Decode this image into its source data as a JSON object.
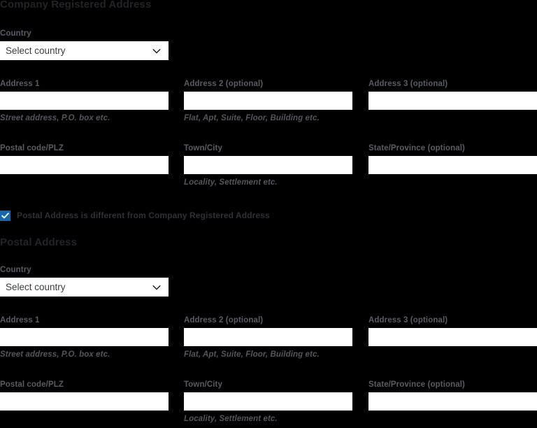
{
  "theme": {
    "background": "#000000",
    "heading_color": "#232427",
    "label_color": "#585c63",
    "helper_color": "#52565c",
    "input_background": "#ffffff",
    "checkbox_accent": "#1768ab"
  },
  "sections": [
    {
      "id": "company-registered-address",
      "heading": "Company Registered Address",
      "country": {
        "label": "Country",
        "placeholder": "Select country",
        "value": "Select country",
        "options": [
          "Select country"
        ],
        "chevron_icon": "chevron-down-icon"
      },
      "row1": [
        {
          "label": "Address 1",
          "value": "",
          "helper": "Street address, P.O. box etc."
        },
        {
          "label": "Address 2 (optional)",
          "value": "",
          "helper": "Flat, Apt, Suite, Floor, Building etc."
        },
        {
          "label": "Address 3 (optional)",
          "value": "",
          "helper": ""
        }
      ],
      "row2": [
        {
          "label": "Postal code/PLZ",
          "value": "",
          "helper": ""
        },
        {
          "label": "Town/City",
          "value": "",
          "helper": "Locality, Settlement etc."
        },
        {
          "label": "State/Province (optional)",
          "value": "",
          "helper": ""
        }
      ]
    },
    {
      "id": "postal-address",
      "heading": "Postal Address",
      "country": {
        "label": "Country",
        "placeholder": "Select country",
        "value": "Select country",
        "options": [
          "Select country"
        ],
        "chevron_icon": "chevron-down-icon"
      },
      "row1": [
        {
          "label": "Address 1",
          "value": "",
          "helper": "Street address, P.O. box etc."
        },
        {
          "label": "Address 2 (optional)",
          "value": "",
          "helper": "Flat, Apt, Suite, Floor, Building etc."
        },
        {
          "label": "Address 3 (optional)",
          "value": "",
          "helper": ""
        }
      ],
      "row2": [
        {
          "label": "Postal code/PLZ",
          "value": "",
          "helper": ""
        },
        {
          "label": "Town/City",
          "value": "",
          "helper": "Locality, Settlement etc."
        },
        {
          "label": "State/Province (optional)",
          "value": "",
          "helper": ""
        }
      ]
    }
  ],
  "checkbox": {
    "label": "Postal Address is different from Company Registered Address",
    "checked": true,
    "icon": "checkmark-icon"
  }
}
